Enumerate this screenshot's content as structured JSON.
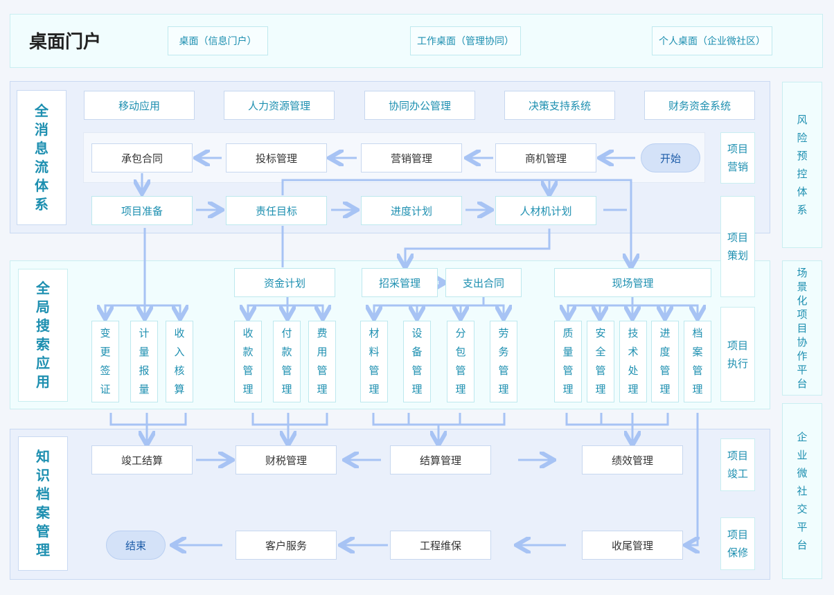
{
  "portal": {
    "title": "桌面门户",
    "tabs": [
      "桌面（信息门户）",
      "工作桌面（管理协同）",
      "个人桌面（企业微社区）"
    ]
  },
  "sections": {
    "s1": "全\n消\n息\n流\n体\n系",
    "s2": "全\n局\n搜\n索\n应\n用",
    "s3": "知\n识\n档\n案\n管\n理"
  },
  "systems": [
    "移动应用",
    "人力资源管理",
    "协同办公管理",
    "决策支持系统",
    "财务资金系统"
  ],
  "marketing": {
    "contract": "承包合同",
    "bidding": "投标管理",
    "sales": "营销管理",
    "opportunity": "商机管理",
    "start": "开始"
  },
  "planning": {
    "prep": "项目准备",
    "target": "责任目标",
    "schedule": "进度计划",
    "resource": "人材机计划"
  },
  "execution": {
    "fund": "资金计划",
    "procure": "招采管理",
    "expense": "支出合同",
    "site": "现场管理",
    "cols": [
      "变\n更\n签\n证",
      "计\n量\n报\n量",
      "收\n入\n核\n算",
      "收\n款\n管\n理",
      "付\n款\n管\n理",
      "费\n用\n管\n理",
      "材\n料\n管\n理",
      "设\n备\n管\n理",
      "分\n包\n管\n理",
      "劳\n务\n管\n理",
      "质\n量\n管\n理",
      "安\n全\n管\n理",
      "技\n术\n处\n理",
      "进\n度\n管\n理",
      "档\n案\n管\n理"
    ]
  },
  "completion": {
    "final": "竣工结算",
    "tax": "财税管理",
    "settle": "结算管理",
    "perf": "绩效管理",
    "end": "结束",
    "service": "客户服务",
    "maint": "工程维保",
    "closeout": "收尾管理"
  },
  "stages": [
    "项目\n营销",
    "项目\n策划",
    "项目\n执行",
    "项目\n竣工",
    "项目\n保修"
  ],
  "right_bars": [
    "风\n险\n预\n控\n体\n系",
    "场\n景\n化\n项\n目\n协\n作\n平\n台",
    "企\n业\n微\n社\n交\n平\n台"
  ],
  "colors": {
    "arrow": "#a7c3f4",
    "accent": "#1d8fb0"
  }
}
